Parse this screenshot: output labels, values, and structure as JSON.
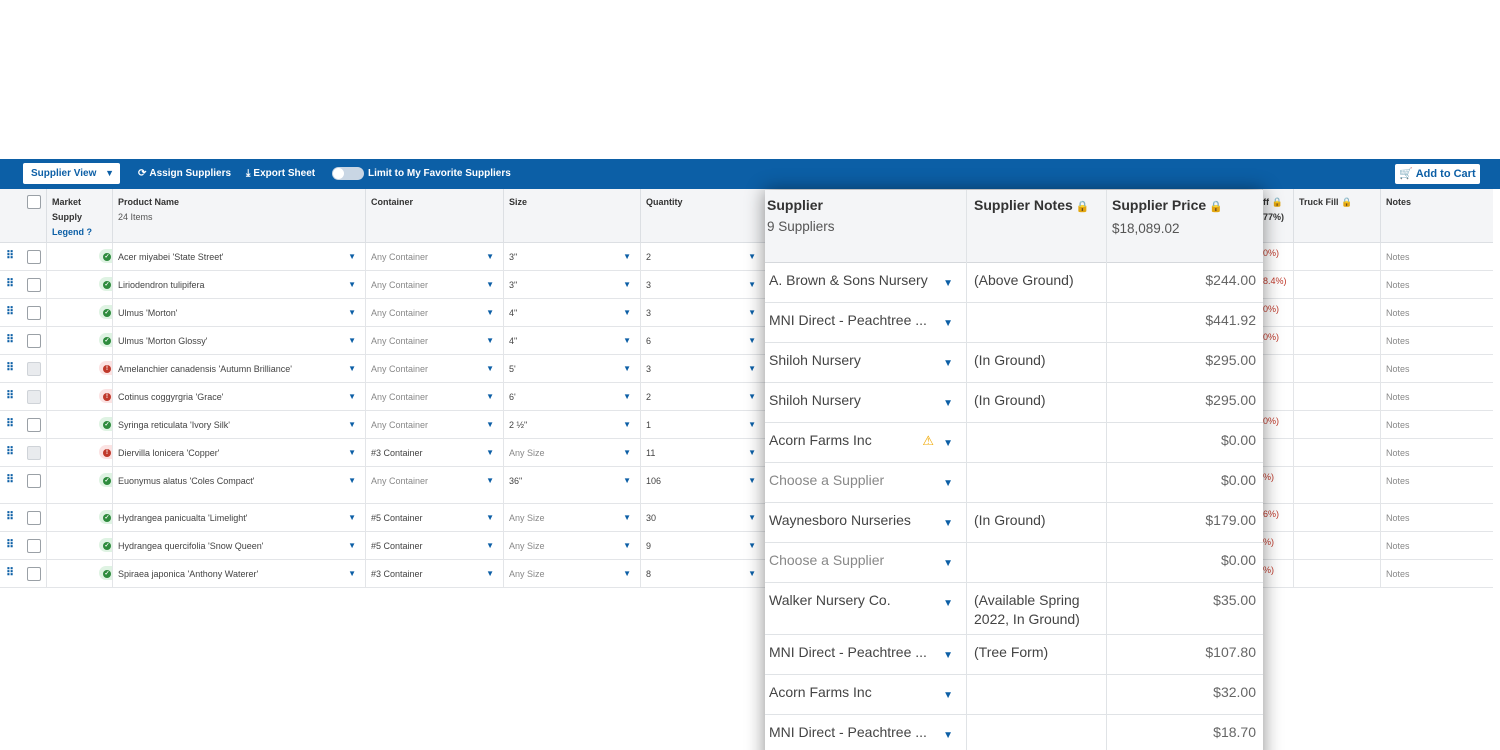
{
  "toolbar": {
    "view_select": "Supplier View",
    "assign": "Assign Suppliers",
    "export": "Export Sheet",
    "favorite_toggle": "Limit to My Favorite Suppliers",
    "add_to_cart": "Add to Cart"
  },
  "header": {
    "market_supply": "Market Supply",
    "legend": "Legend",
    "product_name": "Product Name",
    "item_count": "24 Items",
    "container": "Container",
    "size": "Size",
    "quantity": "Quantity",
    "diff_partial": "ff",
    "diff_pct": "77%)",
    "truck_fill": "Truck Fill",
    "notes": "Notes"
  },
  "rows": [
    {
      "supply": "Strong",
      "product": "Acer miyabei 'State Street'",
      "container": "Any Container",
      "size": "3\"",
      "qty": "2",
      "diff": "0%)",
      "notes": "Notes"
    },
    {
      "supply": "Strong",
      "product": "Liriodendron tulipifera",
      "container": "Any Container",
      "size": "3\"",
      "qty": "3",
      "diff": "8.4%)",
      "notes": "Notes"
    },
    {
      "supply": "Strong",
      "product": "Ulmus 'Morton'",
      "container": "Any Container",
      "size": "4\"",
      "qty": "3",
      "diff": "0%)",
      "notes": "Notes"
    },
    {
      "supply": "Strong",
      "product": "Ulmus 'Morton Glossy'",
      "container": "Any Container",
      "size": "4\"",
      "qty": "6",
      "diff": "0%)",
      "notes": "Notes"
    },
    {
      "supply": "Uncertain",
      "product": "Amelanchier canadensis 'Autumn Brilliance'",
      "container": "Any Container",
      "size": "5'",
      "qty": "3",
      "diff": "",
      "notes": "Notes"
    },
    {
      "supply": "Uncertain",
      "product": "Cotinus coggyrgria 'Grace'",
      "container": "Any Container",
      "size": "6'",
      "qty": "2",
      "diff": "",
      "notes": "Notes"
    },
    {
      "supply": "Strong",
      "product": "Syringa reticulata 'Ivory Silk'",
      "container": "Any Container",
      "size": "2 ½\"",
      "qty": "1",
      "diff": "0%)",
      "notes": "Notes"
    },
    {
      "supply": "Uncertain",
      "product": "Diervilla lonicera 'Copper'",
      "container": "#3 Container",
      "size": "Any Size",
      "qty": "11",
      "diff": "",
      "notes": "Notes"
    },
    {
      "supply": "Strong",
      "product": "Euonymus alatus 'Coles Compact'",
      "container": "Any Container",
      "size": "36\"",
      "qty": "106",
      "diff": "%)",
      "notes": "Notes"
    },
    {
      "supply": "Strong",
      "product": "Hydrangea panicualta 'Limelight'",
      "container": "#5 Container",
      "size": "Any Size",
      "qty": "30",
      "diff": "6%)",
      "notes": "Notes"
    },
    {
      "supply": "Strong",
      "product": "Hydrangea quercifolia 'Snow Queen'",
      "container": "#5 Container",
      "size": "Any Size",
      "qty": "9",
      "diff": "%)",
      "notes": "Notes"
    },
    {
      "supply": "Strong",
      "product": "Spiraea japonica 'Anthony Waterer'",
      "container": "#3 Container",
      "size": "Any Size",
      "qty": "8",
      "diff": "%)",
      "notes": "Notes"
    }
  ],
  "panel": {
    "supplier_header": "Supplier",
    "supplier_count": "9 Suppliers",
    "notes_header": "Supplier Notes",
    "price_header": "Supplier Price",
    "price_total": "$18,089.02",
    "rows": [
      {
        "supplier": "A. Brown & Sons Nursery",
        "note": "(Above Ground)",
        "price": "$244.00"
      },
      {
        "supplier": "MNI Direct - Peachtree ...",
        "note": "",
        "price": "$441.92"
      },
      {
        "supplier": "Shiloh Nursery",
        "note": "(In Ground)",
        "price": "$295.00"
      },
      {
        "supplier": "Shiloh Nursery",
        "note": "(In Ground)",
        "price": "$295.00"
      },
      {
        "supplier": "Acorn Farms Inc",
        "note": "",
        "price": "$0.00"
      },
      {
        "supplier": "Choose a Supplier",
        "note": "",
        "price": "$0.00"
      },
      {
        "supplier": "Waynesboro Nurseries",
        "note": "(In Ground)",
        "price": "$179.00"
      },
      {
        "supplier": "Choose a Supplier",
        "note": "",
        "price": "$0.00"
      },
      {
        "supplier": "Walker Nursery Co.",
        "note": "(Available Spring 2022, In Ground)",
        "price": "$35.00"
      },
      {
        "supplier": "MNI Direct - Peachtree ...",
        "note": "(Tree Form)",
        "price": "$107.80"
      },
      {
        "supplier": "Acorn Farms Inc",
        "note": "",
        "price": "$32.00"
      },
      {
        "supplier": "MNI Direct - Peachtree ...",
        "note": "",
        "price": "$18.70"
      }
    ]
  },
  "colors": {
    "brand": "#0c5fa6",
    "strong": "#2e8b3d",
    "uncertain": "#c0392b",
    "warning": "#f0a800"
  }
}
